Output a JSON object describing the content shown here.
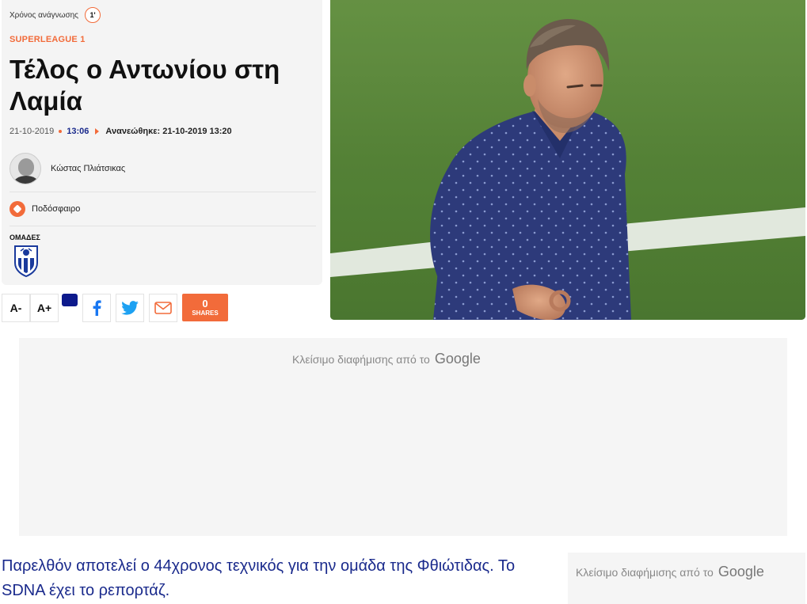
{
  "article": {
    "reading_time_label": "Χρόνος ανάγνωσης",
    "reading_time_value": "1'",
    "category": "SUPERLEAGUE 1",
    "title": "Τέλος ο Αντωνίου στη Λαμία",
    "date": "21-10-2019",
    "time": "13:06",
    "updated": "Ανανεώθηκε: 21-10-2019 13:20",
    "author": "Κώστας Πλιάτσικας",
    "sport": "Ποδόσφαιρο",
    "teams_label": "ΟΜΑΔΕΣ",
    "body": "Παρελθόν αποτελεί ο 44χρονος τεχνικός για την ομάδα της Φθιώτιδας. Το SDNA έχει το ρεπορτάζ."
  },
  "toolbar": {
    "font_smaller": "A-",
    "font_larger": "A+",
    "share_count": "0",
    "share_label": "SHARES"
  },
  "ads": {
    "close_text": "Κλείσιμο διαφήμισης από το",
    "brand": "Google"
  },
  "colors": {
    "accent": "#f26b3a",
    "link": "#1a2a8c",
    "facebook": "#1877f2",
    "twitter": "#1da1f2"
  },
  "icons": [
    "reading-time-badge",
    "football-icon",
    "team-crest",
    "facebook-icon",
    "twitter-icon",
    "email-icon"
  ]
}
